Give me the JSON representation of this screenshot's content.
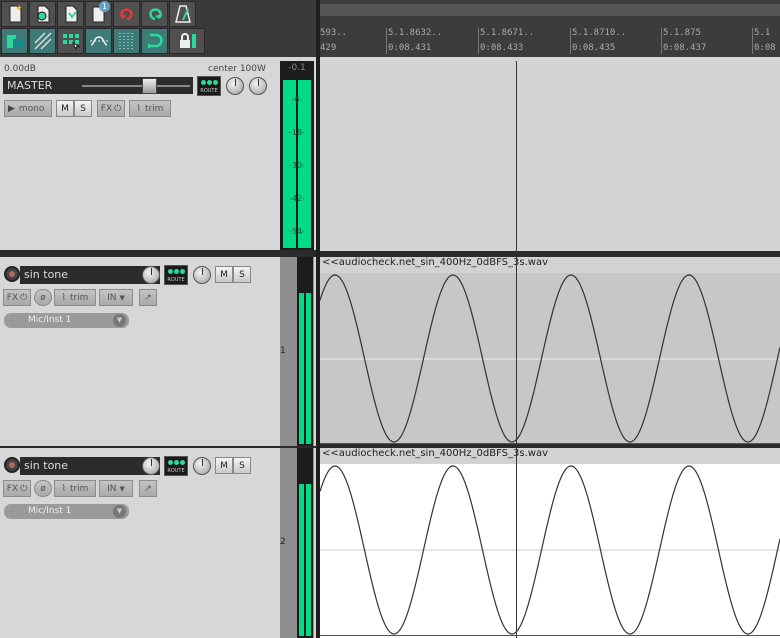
{
  "toolbar": {
    "buttons": [
      {
        "name": "new-project-icon"
      },
      {
        "name": "open-project-icon"
      },
      {
        "name": "save-project-icon"
      },
      {
        "name": "project-settings-icon",
        "badge": "1"
      },
      {
        "name": "undo-icon"
      },
      {
        "name": "redo-icon"
      },
      {
        "name": "metronome-icon"
      },
      {
        "name": "auto-crossfade-icon"
      },
      {
        "name": "ripple-edit-icon"
      },
      {
        "name": "grid-icon"
      },
      {
        "name": "envelope-link-icon"
      },
      {
        "name": "snap-grid-icon"
      },
      {
        "name": "loop-icon"
      },
      {
        "name": "lock-icon"
      }
    ]
  },
  "master": {
    "volume": "0.00dB",
    "pan": "center 100W",
    "name": "MASTER",
    "route": "ROUTE",
    "mono": "mono",
    "mute": "M",
    "solo": "S",
    "fx": "FX",
    "trim": "trim",
    "peak": "-0.1",
    "meter_ticks": [
      "-6-",
      "-18-",
      "-30-",
      "-42-",
      "-54-"
    ]
  },
  "tracks": [
    {
      "name": "sin tone",
      "route": "ROUTE",
      "mute": "M",
      "solo": "S",
      "fx": "FX",
      "trim": "trim",
      "in": "IN",
      "input": "Mic/Inst 1",
      "number": "1",
      "item": "<<audiocheck.net_sin_400Hz_0dBFS_3s.wav"
    },
    {
      "name": "sin tone",
      "route": "ROUTE",
      "mute": "M",
      "solo": "S",
      "fx": "FX",
      "trim": "trim",
      "in": "IN",
      "input": "Mic/Inst 1",
      "number": "2",
      "item": "<<audiocheck.net_sin_400Hz_0dBFS_3s.wav"
    }
  ],
  "ruler": {
    "measures": [
      "593..",
      "5.1.8632..",
      "5.1.8671..",
      "5.1.8710..",
      "5.1.875",
      "5.1"
    ],
    "times": [
      "429",
      "0:08.431",
      "0:08.433",
      "0:08.435",
      "0:08.437",
      "0:08"
    ]
  },
  "colors": {
    "meter": "#00dc86",
    "background": "#d7d7d7",
    "dark": "#2b2b2b"
  }
}
